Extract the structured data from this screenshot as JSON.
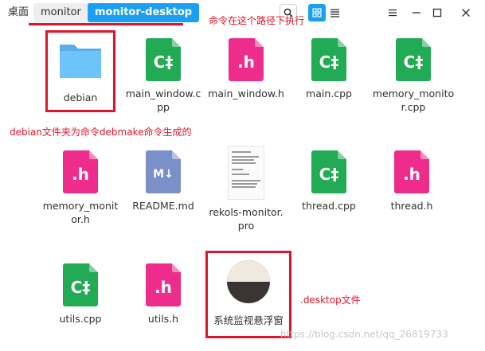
{
  "breadcrumb": {
    "root": "桌面",
    "mid": "monitor",
    "active": "monitor-desktop"
  },
  "annotations": {
    "path_note": "命令在这个路径下执行",
    "debian_note": "debian文件夹为命令debmake命令生成的",
    "desktop_note": ".desktop文件"
  },
  "icons": {
    "search": "search-icon",
    "grid": "grid-view-icon",
    "list": "list-view-icon",
    "menu": "menu-icon",
    "minimize": "minimize-icon",
    "maximize": "maximize-icon",
    "close": "close-icon"
  },
  "colors": {
    "accent": "#1a9ff3",
    "cpp": "#22aa55",
    "header": "#ee2c8c",
    "markdown": "#7b8fc8",
    "folder": "#5bbcf7",
    "annotation": "#e0142a"
  },
  "files": [
    {
      "name": "debian",
      "type": "folder"
    },
    {
      "name": "main_window.cpp",
      "type": "cpp",
      "glyph": "C‡"
    },
    {
      "name": "main_window.h",
      "type": "h",
      "glyph": ".h"
    },
    {
      "name": "main.cpp",
      "type": "cpp",
      "glyph": "C‡"
    },
    {
      "name": "memory_monitor.cpp",
      "type": "cpp",
      "glyph": "C‡"
    },
    {
      "name": "memory_monitor.h",
      "type": "h",
      "glyph": ".h"
    },
    {
      "name": "README.md",
      "type": "md",
      "glyph": "M↓"
    },
    {
      "name": "rekols-monitor.pro",
      "type": "pro"
    },
    {
      "name": "thread.cpp",
      "type": "cpp",
      "glyph": "C‡"
    },
    {
      "name": "thread.h",
      "type": "h",
      "glyph": ".h"
    },
    {
      "name": "utils.cpp",
      "type": "cpp",
      "glyph": "C‡"
    },
    {
      "name": "utils.h",
      "type": "h",
      "glyph": ".h"
    },
    {
      "name": "系统监视悬浮窗",
      "type": "desktop"
    }
  ],
  "watermark": "https://blog.csdn.net/qq_26819733"
}
